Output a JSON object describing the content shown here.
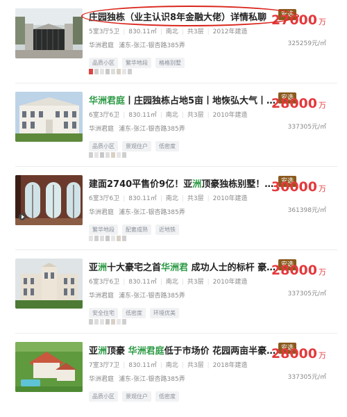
{
  "listings": [
    {
      "title_parts": [
        {
          "t": "庄园独栋（业主认识8年金融大佬）详情私聊",
          "hl": false
        }
      ],
      "badge": "安选",
      "layout": "5室3厅5卫",
      "area": "830.11㎡",
      "orientation": "南北",
      "floors": "共3层",
      "built": "2012年建造",
      "community": "华洲君庭",
      "district": "浦东-张江-银杏路385弄",
      "tags": [
        "品质小区",
        "繁华地段",
        "格格别墅"
      ],
      "price": "27000",
      "price_unit": "万",
      "unit_price": "325259元/㎡"
    },
    {
      "title_parts": [
        {
          "t": "华洲君庭",
          "hl": true
        },
        {
          "t": "丨庄园独栋占地5亩丨地恢弘大气丨…",
          "hl": false
        }
      ],
      "badge": "安选",
      "layout": "6室3厅6卫",
      "area": "830.11㎡",
      "orientation": "南北",
      "floors": "共3层",
      "built": "2010年建造",
      "community": "华洲君庭",
      "district": "浦东-张江-银杏路385弄",
      "tags": [
        "品质小区",
        "景观住户",
        "低密度"
      ],
      "price": "28000",
      "price_unit": "万",
      "unit_price": "337305元/㎡"
    },
    {
      "title_parts": [
        {
          "t": "建面2740平售价9亿！亚",
          "hl": false
        },
        {
          "t": "洲",
          "hl": true
        },
        {
          "t": "顶豪独栋别墅！…",
          "hl": false
        }
      ],
      "badge": "安选",
      "layout": "6室3厅6卫",
      "area": "830.11㎡",
      "orientation": "南北",
      "floors": "共3层",
      "built": "2010年建造",
      "community": "华洲君庭",
      "district": "浦东-张江-银杏路385弄",
      "tags": [
        "繁华地段",
        "配套成熟",
        "近地铁"
      ],
      "price": "30000",
      "price_unit": "万",
      "unit_price": "361398元/㎡"
    },
    {
      "title_parts": [
        {
          "t": "亚",
          "hl": false
        },
        {
          "t": "洲",
          "hl": true
        },
        {
          "t": "十大豪宅之首",
          "hl": false
        },
        {
          "t": "华洲君",
          "hl": true
        },
        {
          "t": " 成功人士的标杆 豪…",
          "hl": false
        }
      ],
      "badge": "安选",
      "layout": "6室3厅6卫",
      "area": "830.11㎡",
      "orientation": "南北",
      "floors": "共3层",
      "built": "2010年建造",
      "community": "华洲君庭",
      "district": "浦东-张江-银杏路385弄",
      "tags": [
        "安全住宅",
        "低密度",
        "环境优美"
      ],
      "price": "28000",
      "price_unit": "万",
      "unit_price": "337305元/㎡"
    },
    {
      "title_parts": [
        {
          "t": "亚",
          "hl": false
        },
        {
          "t": "洲",
          "hl": true
        },
        {
          "t": "顶豪 ",
          "hl": false
        },
        {
          "t": "华洲君庭",
          "hl": true
        },
        {
          "t": "低于市场价 花园两亩半豪…",
          "hl": false
        }
      ],
      "badge": "安选",
      "layout": "7室3厅7卫",
      "area": "830.11㎡",
      "orientation": "南北",
      "floors": "共3层",
      "built": "2018年建造",
      "community": "华洲君庭",
      "district": "浦东-张江-银杏路385弄",
      "tags": [
        "品质小区",
        "景观住户",
        "低密度"
      ],
      "price": "28000",
      "price_unit": "万",
      "unit_price": "337305元/㎡"
    }
  ]
}
